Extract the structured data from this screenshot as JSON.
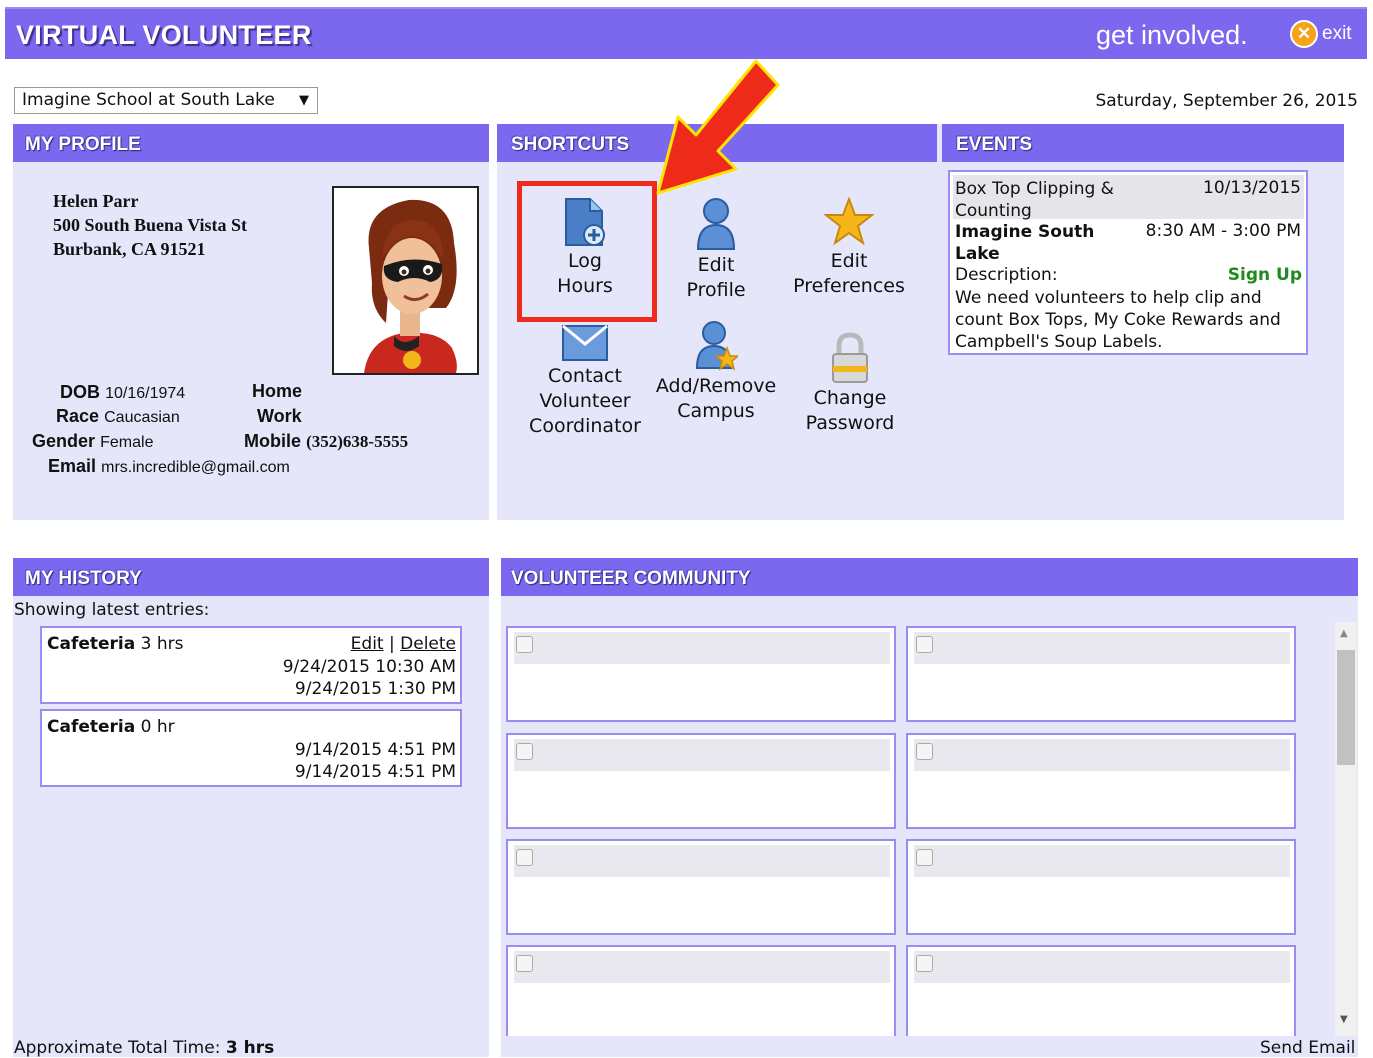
{
  "header": {
    "title": "VIRTUAL VOLUNTEER",
    "tagline": "get involved.",
    "exit_label": "exit"
  },
  "school_select": {
    "value": "Imagine School at South Lake"
  },
  "date": "Saturday, September 26, 2015",
  "profile": {
    "title": "MY PROFILE",
    "name": "Helen Parr",
    "address1": "500 South Buena Vista St",
    "address2": "Burbank, CA 91521",
    "dob_label": "DOB",
    "dob": "10/16/1974",
    "race_label": "Race",
    "race": "Caucasian",
    "gender_label": "Gender",
    "gender": "Female",
    "email_label": "Email",
    "email": "mrs.incredible@gmail.com",
    "home_label": "Home",
    "work_label": "Work",
    "mobile_label": "Mobile",
    "mobile": "(352)638-5555"
  },
  "shortcuts": {
    "title": "SHORTCUTS",
    "log_hours_1": "Log",
    "log_hours_2": "Hours",
    "edit_profile_1": "Edit",
    "edit_profile_2": "Profile",
    "edit_prefs_1": "Edit",
    "edit_prefs_2": "Preferences",
    "contact_1": "Contact",
    "contact_2": "Volunteer",
    "contact_3": "Coordinator",
    "campus_1": "Add/Remove",
    "campus_2": "Campus",
    "password_1": "Change",
    "password_2": "Password"
  },
  "events": {
    "title": "EVENTS",
    "name1": "Box Top Clipping &",
    "name2": "Counting",
    "date": "10/13/2015",
    "location1": "Imagine South",
    "location2": "Lake",
    "time": "8:30 AM - 3:00 PM",
    "desc_label": "Description:",
    "signup": "Sign Up",
    "desc1": "We need volunteers to help clip and",
    "desc2": "count Box Tops, My Coke Rewards and",
    "desc3": "Campbell's Soup Labels."
  },
  "history": {
    "title": "MY HISTORY",
    "subtitle": "Showing latest entries:",
    "entries": [
      {
        "place": "Cafeteria",
        "hours": "3 hrs",
        "start": "9/24/2015 10:30 AM",
        "end": "9/24/2015 1:30 PM",
        "edit": "Edit",
        "sep": "|",
        "delete": "Delete"
      },
      {
        "place": "Cafeteria",
        "hours": "0 hr",
        "start": "9/14/2015 4:51 PM",
        "end": "9/14/2015 4:51 PM"
      }
    ],
    "total_label": "Approximate Total Time:",
    "total_value": "3 hrs"
  },
  "community": {
    "title": "VOLUNTEER COMMUNITY",
    "send_email": "Send Email"
  },
  "colors": {
    "brand": "#7b68ee",
    "panel": "#e6e6fa",
    "highlight": "#ee2a1a",
    "signup": "#1f8a1f"
  },
  "annotation": {
    "arrow_color": "#ee2a1a",
    "arrow_outline": "#ffe400"
  }
}
